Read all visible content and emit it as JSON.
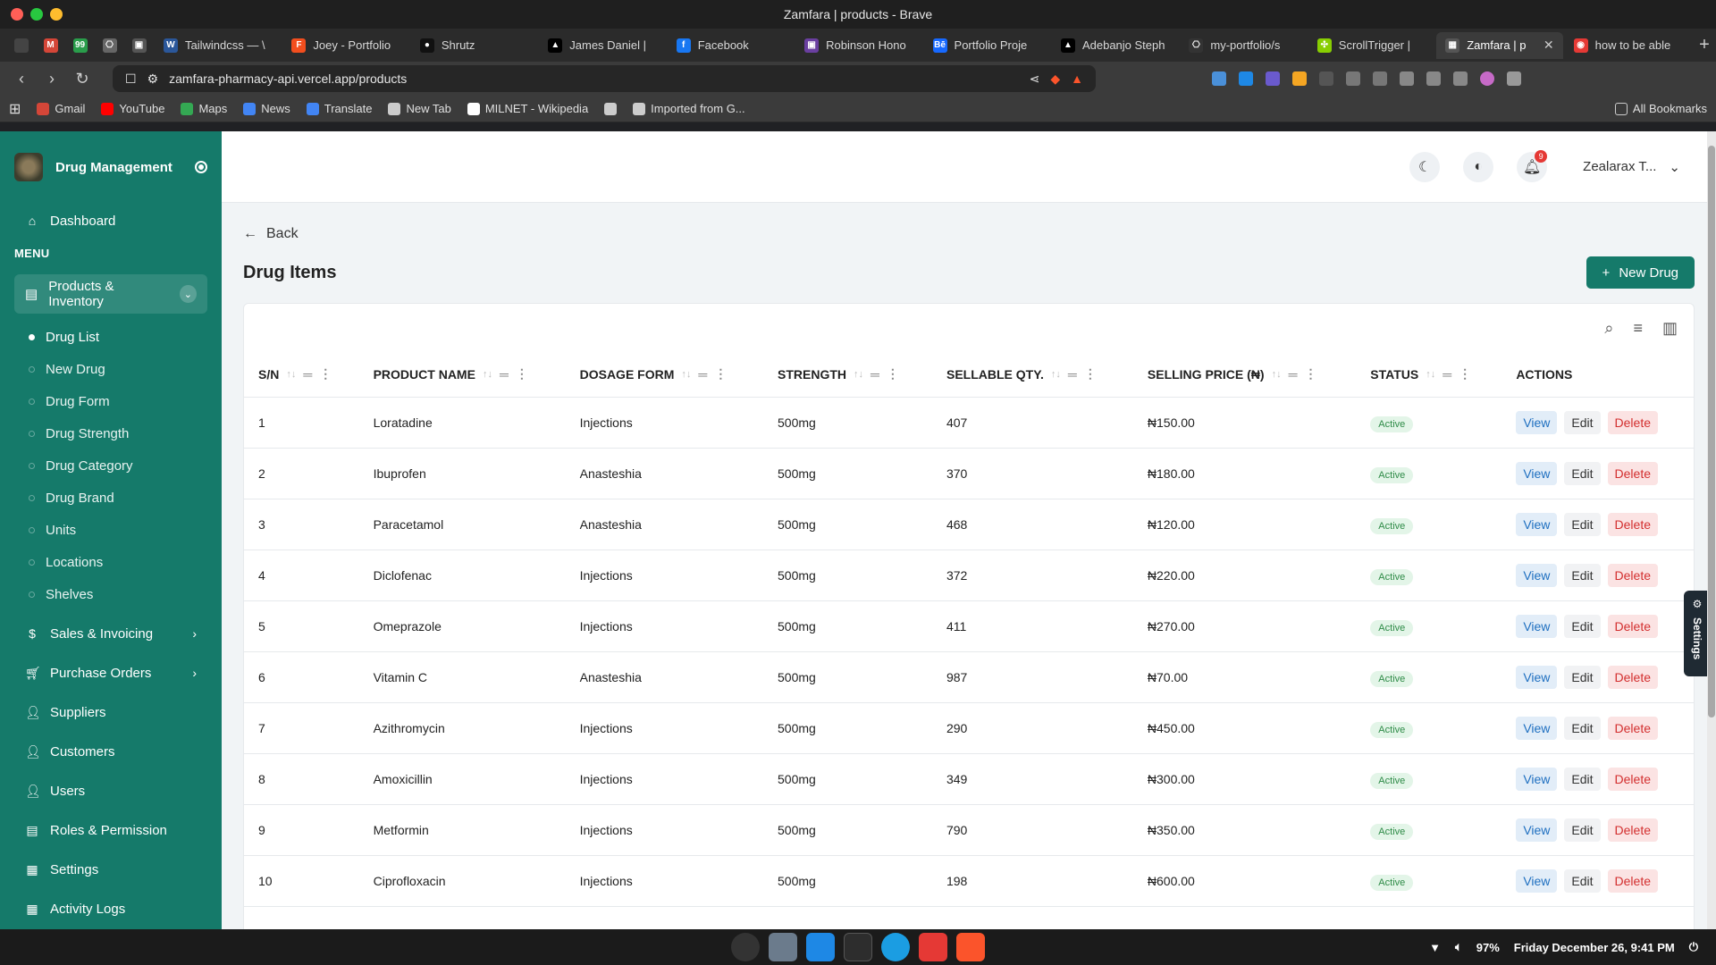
{
  "window": {
    "title": "Zamfara | products - Brave"
  },
  "tabs": [
    {
      "label": "",
      "color": "#444",
      "pinned": true
    },
    {
      "label": "",
      "color": "#d44638",
      "pinned": true,
      "glyph": "M"
    },
    {
      "label": "",
      "color": "#2a9d4b",
      "pinned": true,
      "glyph": "99"
    },
    {
      "label": "",
      "color": "#666",
      "pinned": true,
      "glyph": "⎔"
    },
    {
      "label": "",
      "color": "#555",
      "pinned": true,
      "glyph": "▣"
    },
    {
      "label": "Tailwindcss — \\",
      "color": "#2b579a",
      "glyph": "W"
    },
    {
      "label": "Joey - Portfolio",
      "color": "#f24e1e",
      "glyph": "F"
    },
    {
      "label": "Shrutz",
      "color": "#111",
      "glyph": "●"
    },
    {
      "label": "James Daniel |",
      "color": "#000",
      "glyph": "▲"
    },
    {
      "label": "Facebook",
      "color": "#1877f2",
      "glyph": "f"
    },
    {
      "label": "Robinson Hono",
      "color": "#6a3fa0",
      "glyph": "▣"
    },
    {
      "label": "Portfolio Proje",
      "color": "#1769ff",
      "glyph": "Bē"
    },
    {
      "label": "Adebanjo Steph",
      "color": "#000",
      "glyph": "▲"
    },
    {
      "label": "my-portfolio/s",
      "color": "#333",
      "glyph": "⎔"
    },
    {
      "label": "ScrollTrigger |",
      "color": "#88ce02",
      "glyph": "✣"
    },
    {
      "label": "Zamfara | p",
      "color": "#555",
      "glyph": "▦",
      "active": true
    },
    {
      "label": "how to be able",
      "color": "#e53935",
      "glyph": "◉"
    }
  ],
  "address": {
    "url": "zamfara-pharmacy-api.vercel.app/products"
  },
  "bookmarks": [
    {
      "label": "Gmail",
      "color": "#d44638"
    },
    {
      "label": "YouTube",
      "color": "#ff0000"
    },
    {
      "label": "Maps",
      "color": "#34a853"
    },
    {
      "label": "News",
      "color": "#4285f4"
    },
    {
      "label": "Translate",
      "color": "#4285f4"
    },
    {
      "label": "New Tab",
      "color": "#ccc"
    },
    {
      "label": "MILNET - Wikipedia",
      "color": "#fff"
    },
    {
      "label": "",
      "color": "#ccc"
    },
    {
      "label": "Imported from G...",
      "color": "#ccc"
    }
  ],
  "bookmarks_right": "All Bookmarks",
  "sidebar": {
    "brand": "Drug Management",
    "dashboard": "Dashboard",
    "menu_label": "MENU",
    "group": "Products & Inventory",
    "sub_items": [
      "Drug List",
      "New Drug",
      "Drug Form",
      "Drug Strength",
      "Drug Category",
      "Drug Brand",
      "Units",
      "Locations",
      "Shelves"
    ],
    "items": [
      "Sales & Invoicing",
      "Purchase Orders",
      "Suppliers",
      "Customers",
      "Users",
      "Roles & Permission",
      "Settings",
      "Activity Logs"
    ]
  },
  "topbar": {
    "notif_count": "9",
    "user_name": "Zealarax T..."
  },
  "page": {
    "back": "Back",
    "title": "Drug Items",
    "new_button": "New Drug"
  },
  "table": {
    "headers": [
      "S/N",
      "PRODUCT NAME",
      "DOSAGE FORM",
      "STRENGTH",
      "SELLABLE QTY.",
      "SELLING PRICE (₦)",
      "STATUS",
      "ACTIONS"
    ],
    "rows": [
      [
        "1",
        "Loratadine",
        "Injections",
        "500mg",
        "407",
        "₦150.00",
        "Active"
      ],
      [
        "2",
        "Ibuprofen",
        "Anasteshia",
        "500mg",
        "370",
        "₦180.00",
        "Active"
      ],
      [
        "3",
        "Paracetamol",
        "Anasteshia",
        "500mg",
        "468",
        "₦120.00",
        "Active"
      ],
      [
        "4",
        "Diclofenac",
        "Injections",
        "500mg",
        "372",
        "₦220.00",
        "Active"
      ],
      [
        "5",
        "Omeprazole",
        "Injections",
        "500mg",
        "411",
        "₦270.00",
        "Active"
      ],
      [
        "6",
        "Vitamin C",
        "Anasteshia",
        "500mg",
        "987",
        "₦70.00",
        "Active"
      ],
      [
        "7",
        "Azithromycin",
        "Injections",
        "500mg",
        "290",
        "₦450.00",
        "Active"
      ],
      [
        "8",
        "Amoxicillin",
        "Injections",
        "500mg",
        "349",
        "₦300.00",
        "Active"
      ],
      [
        "9",
        "Metformin",
        "Injections",
        "500mg",
        "790",
        "₦350.00",
        "Active"
      ],
      [
        "10",
        "Ciprofloxacin",
        "Injections",
        "500mg",
        "198",
        "₦600.00",
        "Active"
      ]
    ],
    "actions": {
      "view": "View",
      "edit": "Edit",
      "delete": "Delete"
    }
  },
  "settings_tab": "Settings",
  "taskbar": {
    "battery": "97%",
    "datetime": "Friday December 26, 9:41 PM"
  }
}
